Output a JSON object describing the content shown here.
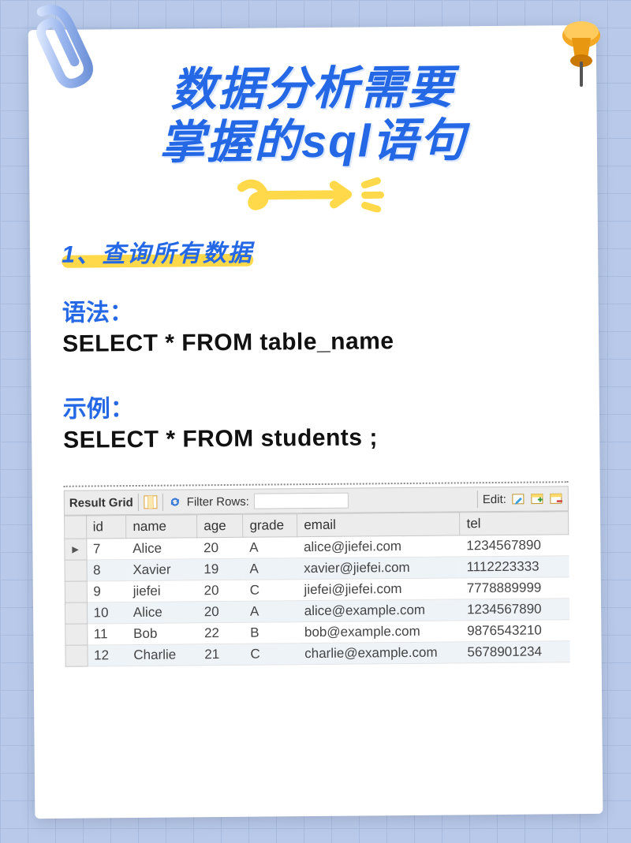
{
  "title_line1": "数据分析需要",
  "title_line2": "掌握的sql语句",
  "section_heading": "1、查询所有数据",
  "syntax_label": "语法：",
  "syntax_code": "SELECT * FROM table_name",
  "example_label": "示例：",
  "example_code": "SELECT * FROM students ;",
  "grid": {
    "title": "Result Grid",
    "filter_label": "Filter Rows:",
    "filter_value": "",
    "edit_label": "Edit:",
    "columns": [
      "id",
      "name",
      "age",
      "grade",
      "email",
      "tel"
    ],
    "rows": [
      {
        "marker": "▸",
        "id": "7",
        "name": "Alice",
        "age": "20",
        "grade": "A",
        "email": "alice@jiefei.com",
        "tel": "1234567890"
      },
      {
        "marker": "",
        "id": "8",
        "name": "Xavier",
        "age": "19",
        "grade": "A",
        "email": "xavier@jiefei.com",
        "tel": "1112223333"
      },
      {
        "marker": "",
        "id": "9",
        "name": "jiefei",
        "age": "20",
        "grade": "C",
        "email": "jiefei@jiefei.com",
        "tel": "7778889999"
      },
      {
        "marker": "",
        "id": "10",
        "name": "Alice",
        "age": "20",
        "grade": "A",
        "email": "alice@example.com",
        "tel": "1234567890"
      },
      {
        "marker": "",
        "id": "11",
        "name": "Bob",
        "age": "22",
        "grade": "B",
        "email": "bob@example.com",
        "tel": "9876543210"
      },
      {
        "marker": "",
        "id": "12",
        "name": "Charlie",
        "age": "21",
        "grade": "C",
        "email": "charlie@example.com",
        "tel": "5678901234"
      }
    ]
  }
}
